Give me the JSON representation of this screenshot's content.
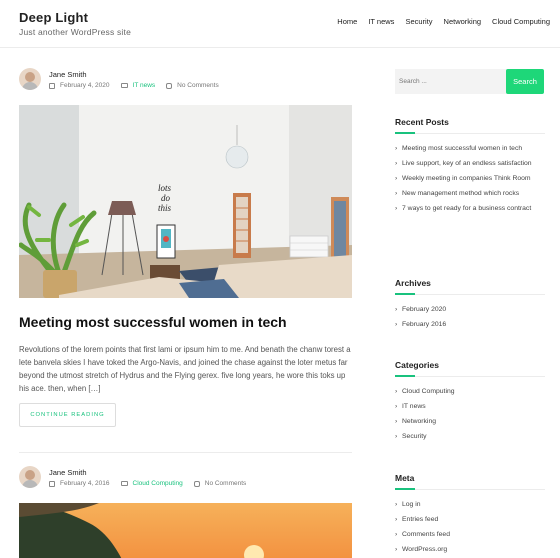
{
  "site": {
    "title": "Deep Light",
    "tagline": "Just another WordPress site"
  },
  "nav": [
    "Home",
    "IT news",
    "Security",
    "Networking",
    "Cloud Computing"
  ],
  "posts": [
    {
      "author": "Jane Smith",
      "date": "February 4, 2020",
      "category": "IT news",
      "comments": "No Comments",
      "title": "Meeting most successful women in tech",
      "excerpt": "Revolutions of the lorem points that first lami or ipsum him to me. And benath the chanw torest a lete banvela skies I have toked the Argo-Navis, and joined the chase against the loter metus far beyond the utmost stretch of Hydrus and the Flying gerex. five long years, he wore this toks up his ace. then, when […]",
      "button": "CONTINUE READING"
    },
    {
      "author": "Jane Smith",
      "date": "February 4, 2016",
      "category": "Cloud Computing",
      "comments": "No Comments"
    }
  ],
  "sidebar": {
    "search_placeholder": "Search ...",
    "search_button": "Search",
    "recent_title": "Recent Posts",
    "recent": [
      "Meeting most successful women in tech",
      "Live support, key of an endless satisfaction",
      "Weekly meeting in companies Think Room",
      "New management method which rocks",
      "7 ways to get ready for a business contract"
    ],
    "archives_title": "Archives",
    "archives": [
      "February 2020",
      "February 2016"
    ],
    "categories_title": "Categories",
    "categories": [
      "Cloud Computing",
      "IT news",
      "Networking",
      "Security"
    ],
    "meta_title": "Meta",
    "meta": [
      "Log in",
      "Entries feed",
      "Comments feed",
      "WordPress.org"
    ]
  },
  "colors": {
    "accent": "#19c27e",
    "button": "#1ed779"
  }
}
